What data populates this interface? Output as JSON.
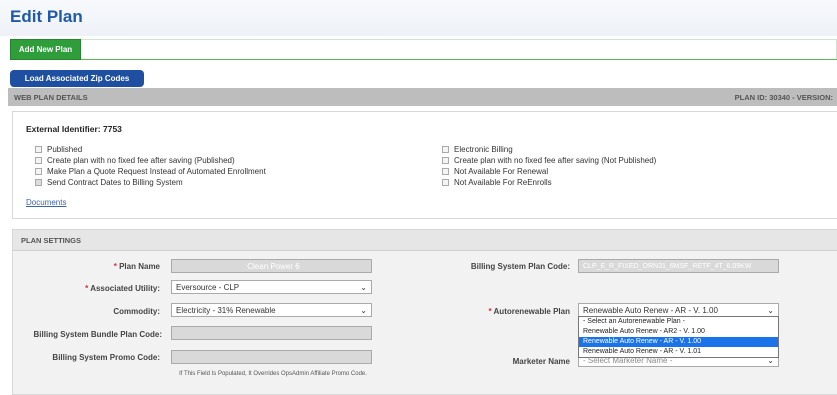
{
  "page": {
    "title": "Edit Plan"
  },
  "actions": {
    "add_new_plan": "Add New Plan",
    "load_zip": "Load Associated Zip Codes"
  },
  "web_plan": {
    "section_title": "WEB PLAN DETAILS",
    "plan_id": "PLAN ID: 30340 - VERSION:",
    "external_identifier": "External Identifier: 7753",
    "left_checkboxes": [
      {
        "label": "Published",
        "disabled": false
      },
      {
        "label": "Create plan with no fixed fee after saving (Published)",
        "disabled": false
      },
      {
        "label": "Make Plan a Quote Request Instead of Automated Enrollment",
        "disabled": false
      },
      {
        "label": "Send Contract Dates to Billing System",
        "disabled": true
      }
    ],
    "right_checkboxes": [
      {
        "label": "Electronic Billing",
        "disabled": false
      },
      {
        "label": "Create plan with no fixed fee after saving (Not Published)",
        "disabled": false
      },
      {
        "label": "Not Available For Renewal",
        "disabled": false
      },
      {
        "label": "Not Available For ReEnrolls",
        "disabled": false
      }
    ],
    "documents_link": "Documents"
  },
  "plan_settings": {
    "section_title": "PLAN SETTINGS",
    "plan_name": {
      "label": "Plan Name",
      "value": "Clean Power 6"
    },
    "associated_utility": {
      "label": "Associated Utility:",
      "value": "Eversource - CLP"
    },
    "commodity": {
      "label": "Commodity:",
      "value": "Electricity - 31% Renewable"
    },
    "bundle_code": {
      "label": "Billing System Bundle Plan Code:",
      "value": ""
    },
    "promo_code": {
      "label": "Billing System Promo Code:",
      "value": ""
    },
    "promo_note": "If This Field Is Populated, It Overrides OpsAdmin Affiliate Promo Code.",
    "billing_plan_code": {
      "label": "Billing System Plan Code:",
      "value": "CLP_E_R_FIXED_ORN31_6MSF_RETF_4T_6.09KW"
    },
    "autorenewable": {
      "label": "Autorenewable Plan",
      "value": "Renewable Auto Renew - AR - V. 1.00",
      "options": [
        "- Select an Autorenewable Plan -",
        "Renewable Auto Renew - AR2 - V. 1.00",
        "Renewable Auto Renew - AR - V. 1.00",
        "Renewable Auto Renew - AR - V. 1.01"
      ],
      "highlighted_index": 2
    },
    "marketer": {
      "label": "Marketer Name",
      "value": "- Select Marketer Name -"
    }
  },
  "colors": {
    "title": "#1f5aa8",
    "green": "#2e9d3a",
    "blue_btn": "#1f4fa0",
    "highlight": "#1a73e8"
  }
}
